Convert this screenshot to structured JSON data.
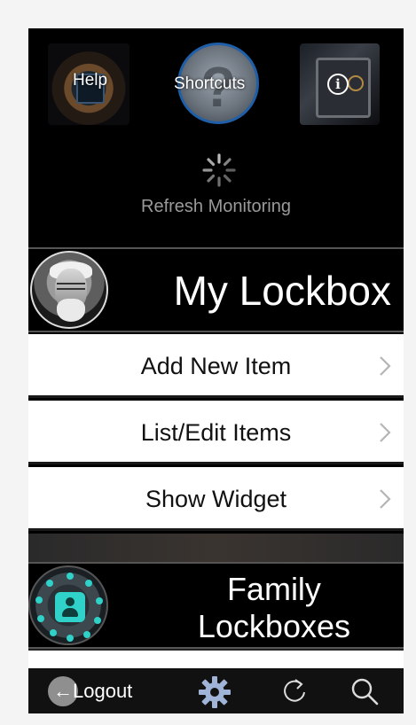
{
  "header": {
    "help_label": "Help",
    "shortcuts_label": "Shortcuts",
    "info_icon": "info-icon",
    "refresh_label": "Refresh Monitoring"
  },
  "my_lockbox": {
    "title": "My Lockbox",
    "menu": [
      {
        "label": "Add New Item"
      },
      {
        "label": "List/Edit Items"
      },
      {
        "label": "Show Widget"
      }
    ]
  },
  "family": {
    "title_line1": "Family",
    "title_line2": "Lockboxes"
  },
  "tabbar": {
    "logout_label": "Logout",
    "icons": [
      "back-arrow-icon",
      "gear-icon",
      "reload-icon",
      "search-icon"
    ]
  },
  "colors": {
    "background": "#000000",
    "menu_row": "#ffffff",
    "accent_teal": "#2fd1c8",
    "shortcut_ring": "#1f5fa8"
  }
}
